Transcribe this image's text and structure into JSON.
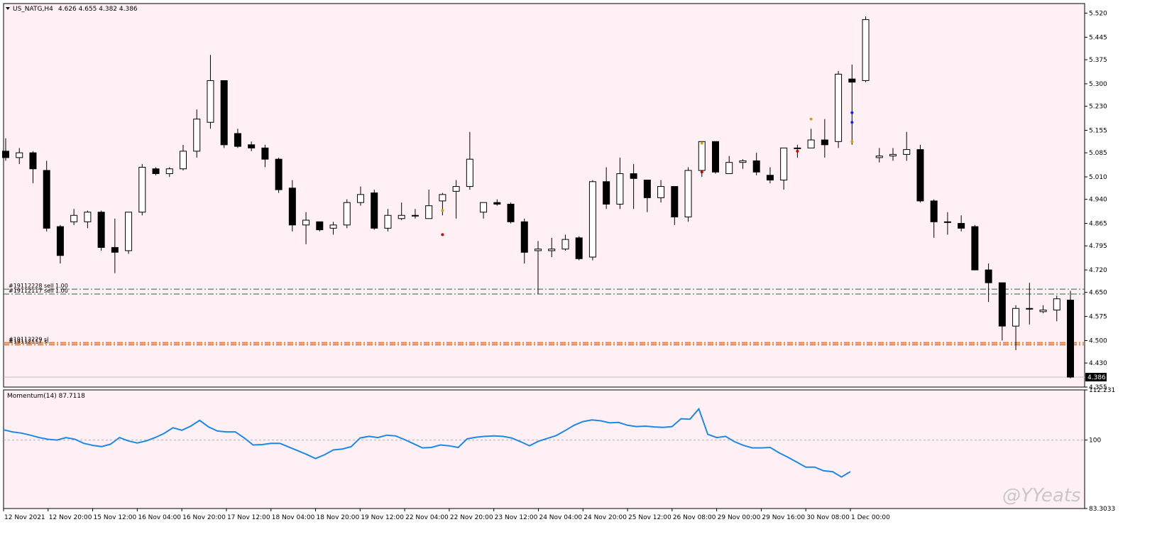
{
  "header": {
    "symbol": "US_NATG,H4",
    "ohlc": "4.626 4.655 4.382 4.386"
  },
  "watermark": "@YYeats",
  "orders": [
    {
      "label": "#19112228 sell 1.00",
      "price": 4.66
    },
    {
      "label": "#19112117 sell 1.00",
      "price": 4.645
    },
    {
      "label": "#19112229 sl",
      "price": 4.493
    },
    {
      "label": "#19112117 sl",
      "price": 4.487
    }
  ],
  "colors": {
    "background": "#fff0f5",
    "frame": "#000000",
    "order_line": "#1f6b2e",
    "sl_line": "#e08040",
    "momentum_line": "#1e88e5",
    "bid_line": "#c0c0c0",
    "trade_buy": "#1a1aff",
    "trade_sell": "#d40000",
    "trade_close": "#d4a017"
  },
  "chart_data": [
    {
      "type": "candlestick",
      "symbol": "US_NATG",
      "timeframe": "H4",
      "ylim": [
        4.355,
        5.55
      ],
      "y_ticks": [
        "5.520",
        "5.445",
        "5.375",
        "5.300",
        "5.230",
        "5.155",
        "5.085",
        "5.010",
        "4.940",
        "4.865",
        "4.795",
        "4.720",
        "4.650",
        "4.575",
        "4.500",
        "4.430",
        "4.355"
      ],
      "current_price": "4.386",
      "x_tick_labels": [
        "12 Nov 2021",
        "12 Nov 20:00",
        "15 Nov 12:00",
        "16 Nov 04:00",
        "16 Nov 20:00",
        "17 Nov 12:00",
        "18 Nov 04:00",
        "18 Nov 20:00",
        "19 Nov 12:00",
        "22 Nov 04:00",
        "22 Nov 20:00",
        "23 Nov 12:00",
        "24 Nov 04:00",
        "24 Nov 20:00",
        "25 Nov 12:00",
        "26 Nov 08:00",
        "29 Nov 00:00",
        "29 Nov 16:00",
        "30 Nov 08:00",
        "1 Dec 00:00"
      ],
      "candles": [
        {
          "o": 5.09,
          "h": 5.13,
          "l": 5.06,
          "c": 5.07
        },
        {
          "o": 5.07,
          "h": 5.1,
          "l": 5.05,
          "c": 5.085
        },
        {
          "o": 5.085,
          "h": 5.09,
          "l": 4.99,
          "c": 5.035
        },
        {
          "o": 5.03,
          "h": 5.06,
          "l": 4.84,
          "c": 4.85
        },
        {
          "o": 4.855,
          "h": 4.86,
          "l": 4.74,
          "c": 4.765
        },
        {
          "o": 4.87,
          "h": 4.91,
          "l": 4.86,
          "c": 4.89
        },
        {
          "o": 4.87,
          "h": 4.905,
          "l": 4.85,
          "c": 4.9
        },
        {
          "o": 4.9,
          "h": 4.905,
          "l": 4.78,
          "c": 4.79
        },
        {
          "o": 4.79,
          "h": 4.88,
          "l": 4.71,
          "c": 4.775
        },
        {
          "o": 4.78,
          "h": 4.9,
          "l": 4.77,
          "c": 4.9
        },
        {
          "o": 4.9,
          "h": 5.05,
          "l": 4.89,
          "c": 5.04
        },
        {
          "o": 5.035,
          "h": 5.04,
          "l": 5.015,
          "c": 5.02
        },
        {
          "o": 5.02,
          "h": 5.04,
          "l": 5.01,
          "c": 5.035
        },
        {
          "o": 5.035,
          "h": 5.11,
          "l": 5.03,
          "c": 5.09
        },
        {
          "o": 5.09,
          "h": 5.22,
          "l": 5.07,
          "c": 5.19
        },
        {
          "o": 5.18,
          "h": 5.39,
          "l": 5.16,
          "c": 5.31
        },
        {
          "o": 5.31,
          "h": 5.31,
          "l": 5.1,
          "c": 5.11
        },
        {
          "o": 5.145,
          "h": 5.16,
          "l": 5.1,
          "c": 5.105
        },
        {
          "o": 5.11,
          "h": 5.12,
          "l": 5.09,
          "c": 5.1
        },
        {
          "o": 5.1,
          "h": 5.11,
          "l": 5.04,
          "c": 5.065
        },
        {
          "o": 5.065,
          "h": 5.07,
          "l": 4.96,
          "c": 4.97
        },
        {
          "o": 4.975,
          "h": 5.0,
          "l": 4.84,
          "c": 4.86
        },
        {
          "o": 4.86,
          "h": 4.9,
          "l": 4.8,
          "c": 4.875
        },
        {
          "o": 4.87,
          "h": 4.87,
          "l": 4.84,
          "c": 4.845
        },
        {
          "o": 4.85,
          "h": 4.87,
          "l": 4.83,
          "c": 4.86
        },
        {
          "o": 4.86,
          "h": 4.94,
          "l": 4.85,
          "c": 4.93
        },
        {
          "o": 4.93,
          "h": 4.98,
          "l": 4.92,
          "c": 4.955
        },
        {
          "o": 4.96,
          "h": 4.97,
          "l": 4.845,
          "c": 4.85
        },
        {
          "o": 4.85,
          "h": 4.91,
          "l": 4.84,
          "c": 4.89
        },
        {
          "o": 4.88,
          "h": 4.93,
          "l": 4.875,
          "c": 4.89
        },
        {
          "o": 4.89,
          "h": 4.91,
          "l": 4.88,
          "c": 4.89
        },
        {
          "o": 4.88,
          "h": 4.97,
          "l": 4.88,
          "c": 4.92
        },
        {
          "o": 4.935,
          "h": 4.96,
          "l": 4.89,
          "c": 4.955
        },
        {
          "o": 4.965,
          "h": 5.0,
          "l": 4.88,
          "c": 4.98
        },
        {
          "o": 4.98,
          "h": 5.15,
          "l": 4.97,
          "c": 5.065
        },
        {
          "o": 4.9,
          "h": 4.93,
          "l": 4.88,
          "c": 4.93
        },
        {
          "o": 4.93,
          "h": 4.94,
          "l": 4.92,
          "c": 4.925
        },
        {
          "o": 4.925,
          "h": 4.93,
          "l": 4.865,
          "c": 4.87
        },
        {
          "o": 4.87,
          "h": 4.88,
          "l": 4.74,
          "c": 4.775
        },
        {
          "o": 4.78,
          "h": 4.81,
          "l": 4.645,
          "c": 4.785
        },
        {
          "o": 4.78,
          "h": 4.82,
          "l": 4.76,
          "c": 4.785
        },
        {
          "o": 4.785,
          "h": 4.83,
          "l": 4.78,
          "c": 4.815
        },
        {
          "o": 4.82,
          "h": 4.825,
          "l": 4.75,
          "c": 4.755
        },
        {
          "o": 4.76,
          "h": 5.0,
          "l": 4.75,
          "c": 4.995
        },
        {
          "o": 4.995,
          "h": 5.04,
          "l": 4.91,
          "c": 4.925
        },
        {
          "o": 4.925,
          "h": 5.07,
          "l": 4.91,
          "c": 5.02
        },
        {
          "o": 5.02,
          "h": 5.05,
          "l": 4.91,
          "c": 5.005
        },
        {
          "o": 5.0,
          "h": 5.0,
          "l": 4.9,
          "c": 4.945
        },
        {
          "o": 4.945,
          "h": 5.0,
          "l": 4.93,
          "c": 4.98
        },
        {
          "o": 4.98,
          "h": 4.98,
          "l": 4.86,
          "c": 4.885
        },
        {
          "o": 4.885,
          "h": 5.04,
          "l": 4.87,
          "c": 5.03
        },
        {
          "o": 5.03,
          "h": 5.12,
          "l": 5.01,
          "c": 5.12
        },
        {
          "o": 5.12,
          "h": 5.12,
          "l": 5.02,
          "c": 5.025
        },
        {
          "o": 5.02,
          "h": 5.075,
          "l": 5.02,
          "c": 5.055
        },
        {
          "o": 5.055,
          "h": 5.065,
          "l": 5.035,
          "c": 5.06
        },
        {
          "o": 5.06,
          "h": 5.085,
          "l": 5.015,
          "c": 5.025
        },
        {
          "o": 5.015,
          "h": 5.04,
          "l": 4.99,
          "c": 5.0
        },
        {
          "o": 5.0,
          "h": 5.1,
          "l": 4.97,
          "c": 5.1
        },
        {
          "o": 5.1,
          "h": 5.11,
          "l": 5.07,
          "c": 5.1
        },
        {
          "o": 5.1,
          "h": 5.16,
          "l": 5.1,
          "c": 5.125
        },
        {
          "o": 5.125,
          "h": 5.19,
          "l": 5.07,
          "c": 5.11
        },
        {
          "o": 5.12,
          "h": 5.34,
          "l": 5.1,
          "c": 5.33
        },
        {
          "o": 5.315,
          "h": 5.36,
          "l": 5.11,
          "c": 5.305
        },
        {
          "o": 5.31,
          "h": 5.51,
          "l": 5.305,
          "c": 5.5
        },
        {
          "o": 5.07,
          "h": 5.1,
          "l": 5.055,
          "c": 5.075
        },
        {
          "o": 5.075,
          "h": 5.1,
          "l": 5.06,
          "c": 5.08
        },
        {
          "o": 5.08,
          "h": 5.15,
          "l": 5.06,
          "c": 5.095
        },
        {
          "o": 5.095,
          "h": 5.11,
          "l": 4.93,
          "c": 4.935
        },
        {
          "o": 4.935,
          "h": 4.94,
          "l": 4.82,
          "c": 4.87
        },
        {
          "o": 4.87,
          "h": 4.9,
          "l": 4.83,
          "c": 4.87
        },
        {
          "o": 4.865,
          "h": 4.89,
          "l": 4.84,
          "c": 4.85
        },
        {
          "o": 4.855,
          "h": 4.86,
          "l": 4.72,
          "c": 4.72
        },
        {
          "o": 4.72,
          "h": 4.74,
          "l": 4.62,
          "c": 4.68
        },
        {
          "o": 4.68,
          "h": 4.68,
          "l": 4.5,
          "c": 4.545
        },
        {
          "o": 4.545,
          "h": 4.61,
          "l": 4.47,
          "c": 4.6
        },
        {
          "o": 4.6,
          "h": 4.68,
          "l": 4.55,
          "c": 4.6
        },
        {
          "o": 4.59,
          "h": 4.61,
          "l": 4.585,
          "c": 4.595
        },
        {
          "o": 4.595,
          "h": 4.64,
          "l": 4.56,
          "c": 4.63
        },
        {
          "o": 4.626,
          "h": 4.655,
          "l": 4.382,
          "c": 4.386
        }
      ]
    },
    {
      "type": "line",
      "title": "Momentum(14) 87.7118",
      "ylim": [
        83.3033,
        112.231
      ],
      "y_ticks": [
        "112.231",
        "100",
        "83.3033"
      ],
      "reference_level": 100,
      "values": [
        102.5,
        102,
        101.7,
        101.2,
        100.6,
        100.2,
        100.0,
        100.6,
        100.2,
        99.2,
        98.7,
        98.4,
        99.0,
        100.6,
        99.8,
        99.3,
        99.8,
        100.6,
        101.6,
        103,
        102.4,
        103.4,
        104.8,
        103.2,
        102.2,
        102.0,
        102.0,
        100.5,
        98.8,
        98.9,
        99.2,
        99.2,
        98.3,
        97.4,
        96.5,
        95.5,
        96.4,
        97.6,
        97.8,
        98.4,
        100.5,
        100.9,
        100.6,
        101.2,
        101.0,
        100.1,
        99.1,
        98.1,
        98.2,
        98.8,
        98.6,
        98.2,
        100.3,
        100.7,
        100.9,
        101.0,
        100.9,
        100.5,
        99.6,
        98.6,
        99.7,
        100.4,
        101.1,
        102.3,
        103.6,
        104.5,
        104.9,
        104.7,
        104.2,
        104.3,
        103.6,
        103.3,
        103.4,
        103.2,
        103.1,
        103.3,
        105.2,
        105.1,
        107.6,
        101.4,
        100.6,
        100.9,
        99.6,
        98.7,
        98.1,
        98.1,
        98.2,
        96.9,
        95.8,
        94.6,
        93.4,
        93.4,
        92.5,
        92.3,
        91.0,
        92.3
      ]
    }
  ]
}
